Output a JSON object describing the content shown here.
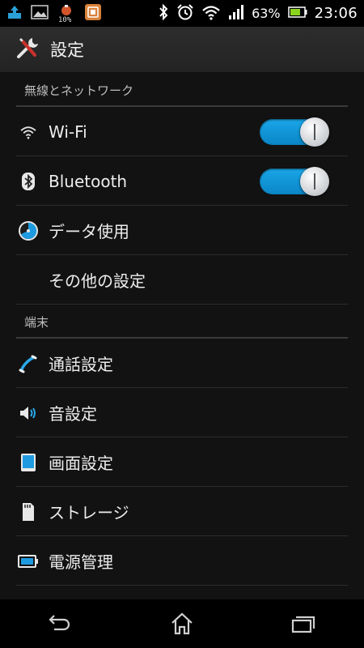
{
  "status_bar": {
    "battery_percent": "63%",
    "time": "23:06",
    "notification_badge": "10%",
    "icons": [
      "upload-icon",
      "image-icon",
      "alarm-badge-icon",
      "app-icon",
      "bluetooth-icon",
      "alarm-clock-icon",
      "wifi-icon",
      "signal-icon",
      "battery-icon"
    ]
  },
  "action_bar": {
    "title": "設定",
    "icon": "tools-icon"
  },
  "sections": {
    "wireless": {
      "header": "無線とネットワーク",
      "items": [
        {
          "label": "Wi-Fi",
          "icon": "wifi-icon",
          "toggle": true
        },
        {
          "label": "Bluetooth",
          "icon": "bluetooth-icon",
          "toggle": true
        },
        {
          "label": "データ使用",
          "icon": "data-usage-icon"
        },
        {
          "label": "その他の設定",
          "icon": ""
        }
      ]
    },
    "device": {
      "header": "端末",
      "items": [
        {
          "label": "通話設定",
          "icon": "phone-icon"
        },
        {
          "label": "音設定",
          "icon": "speaker-icon"
        },
        {
          "label": "画面設定",
          "icon": "display-icon"
        },
        {
          "label": "ストレージ",
          "icon": "sd-card-icon"
        },
        {
          "label": "電源管理",
          "icon": "battery-icon"
        }
      ]
    }
  },
  "navigation": [
    "back-icon",
    "home-icon",
    "recent-apps-icon"
  ],
  "colors": {
    "accent": "#1aa6e8",
    "background": "#121212",
    "action_bar": "#2a2a2a"
  }
}
